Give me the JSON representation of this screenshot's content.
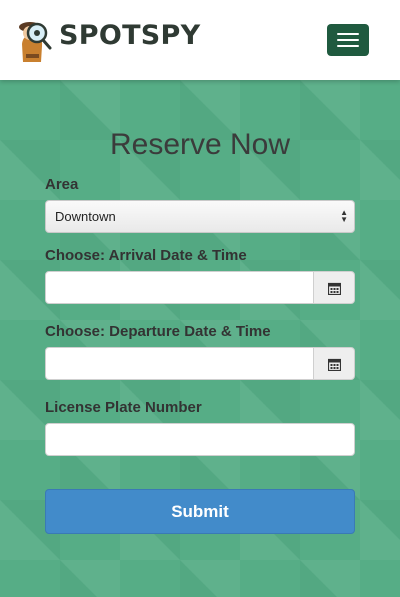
{
  "navbar": {
    "brand": "SPOTSPY",
    "logo_icon": "detective-magnifier-icon",
    "menu_icon": "hamburger-menu-icon",
    "toggle_color": "#1f5a3f"
  },
  "form": {
    "title": "Reserve Now",
    "area_label": "Area",
    "area_selected": "Downtown",
    "arrival_label": "Choose: Arrival Date & Time",
    "arrival_value": "",
    "departure_label": "Choose: Departure Date & Time",
    "departure_value": "",
    "plate_label": "License Plate Number",
    "plate_value": "",
    "calendar_icon": "calendar-icon",
    "submit_label": "Submit"
  },
  "colors": {
    "background": "#56ad86",
    "submit": "#428bca"
  }
}
